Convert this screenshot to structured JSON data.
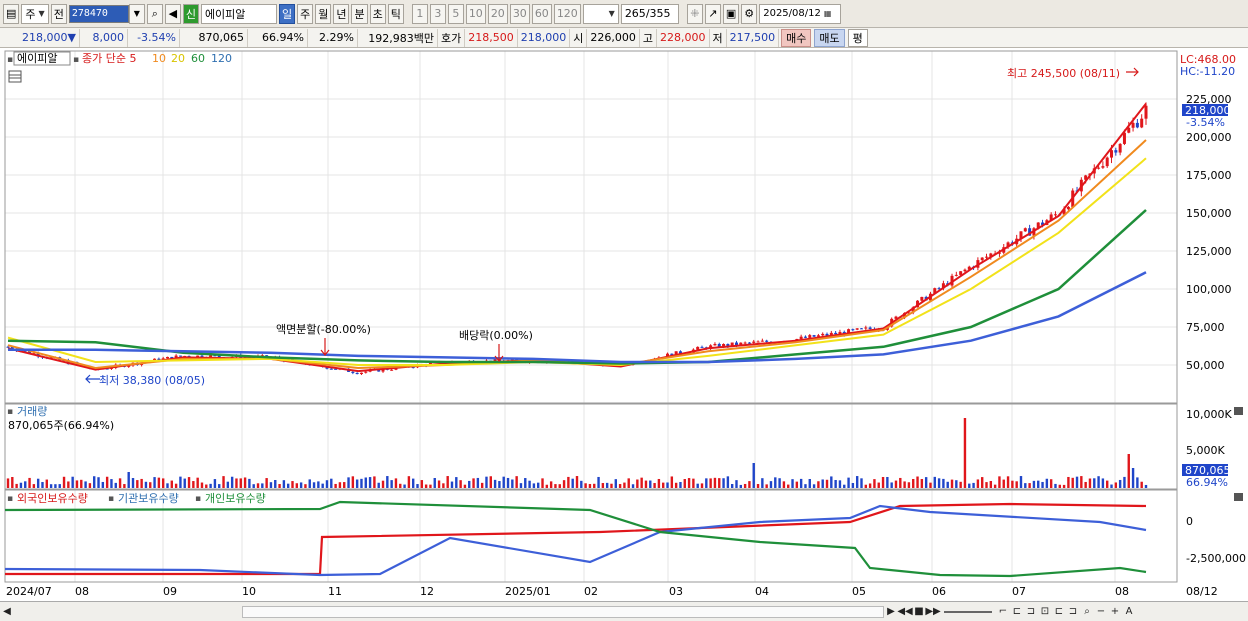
{
  "toolbar": {
    "market": "주",
    "prev_label": "전",
    "code": "278470",
    "sin_label": "신",
    "name": "에이피알",
    "periods": [
      "일",
      "주",
      "월",
      "년",
      "분",
      "초",
      "틱"
    ],
    "active_period": "일",
    "intervals": [
      "1",
      "3",
      "5",
      "10",
      "20",
      "30",
      "60",
      "120"
    ],
    "count": "265",
    "count_total": "/355",
    "date": "2025/08/12"
  },
  "quote": {
    "price": "218,000▼",
    "change": "8,000",
    "change_pct": "-3.54%",
    "volume": "870,065",
    "turnover_pct": "66.94%",
    "ratio": "2.29%",
    "amount": "192,983백만",
    "ask_label": "호가",
    "ask": "218,500",
    "bid": "218,000",
    "open_label": "시",
    "open": "226,000",
    "high_label": "고",
    "high": "228,000",
    "low_label": "저",
    "low": "217,500",
    "buy": "매수",
    "sell": "매도",
    "avg": "평"
  },
  "legend": {
    "stock": "에이피알",
    "ma_label": "종가 단순 5",
    "ma10": "10",
    "ma20": "20",
    "ma60": "60",
    "ma120": "120",
    "lc": "LC:468.00",
    "hc": "HC:-11.20",
    "last_price": "218,000",
    "last_pct": "-3.54%"
  },
  "annotations": {
    "high": "최고 245,500 (08/11)",
    "low": "최저 38,380 (08/05)",
    "split": "액면분할(-80.00%)",
    "dividend": "배당락(0.00%)"
  },
  "volume_panel": {
    "title": "거래량",
    "info": "870,065주(66.94%)",
    "ticks": [
      "10,000K",
      "5,000K"
    ],
    "last": "870,065",
    "last_pct": "66.94%"
  },
  "holders_panel": {
    "foreign": "외국인보유수량",
    "institution": "기관보유수량",
    "individual": "개인보유수량",
    "ticks": [
      "0",
      "-2,500,000"
    ]
  },
  "x_axis": [
    "2024/07",
    "08",
    "09",
    "10",
    "11",
    "12",
    "2025/01",
    "02",
    "03",
    "04",
    "05",
    "06",
    "07",
    "08",
    "08/12"
  ],
  "colors": {
    "up": "#e0161b",
    "down": "#1f45c9",
    "ma5": "#e0161b",
    "ma10": "#f08a1e",
    "ma20": "#f2e21a",
    "ma60": "#1f8f3a",
    "ma120": "#3d5fd8"
  },
  "chart_data": {
    "type": "line",
    "title": "에이피알",
    "y_ticks": [
      50000,
      75000,
      100000,
      125000,
      150000,
      175000,
      200000,
      225000
    ],
    "x": [
      "2024/07",
      "08",
      "09",
      "10",
      "11",
      "12",
      "2025/01",
      "02",
      "03",
      "04",
      "05",
      "06",
      "07",
      "08"
    ],
    "series": [
      {
        "name": "종가",
        "values": [
          62000,
          47000,
          56000,
          55000,
          45000,
          52000,
          53000,
          50000,
          62000,
          67000,
          75000,
          115000,
          150000,
          218000
        ]
      },
      {
        "name": "5",
        "values": [
          61000,
          47000,
          55000,
          54000,
          46000,
          51000,
          53000,
          49000,
          61000,
          66000,
          74000,
          113000,
          148000,
          222000
        ]
      },
      {
        "name": "10",
        "values": [
          63000,
          48000,
          54000,
          54000,
          48000,
          50000,
          53000,
          50000,
          59000,
          65000,
          73000,
          108000,
          145000,
          198000
        ]
      },
      {
        "name": "20",
        "values": [
          68000,
          52000,
          53000,
          54000,
          50000,
          50000,
          52000,
          50000,
          56000,
          63000,
          70000,
          100000,
          137000,
          186000
        ]
      },
      {
        "name": "60",
        "values": [
          66000,
          65000,
          58000,
          55000,
          53000,
          52000,
          52000,
          51000,
          52000,
          57000,
          62000,
          75000,
          100000,
          152000
        ]
      },
      {
        "name": "120",
        "values": [
          60000,
          60000,
          59000,
          58000,
          56000,
          55000,
          54000,
          52000,
          52000,
          54000,
          57000,
          66000,
          82000,
          111000
        ]
      }
    ]
  }
}
